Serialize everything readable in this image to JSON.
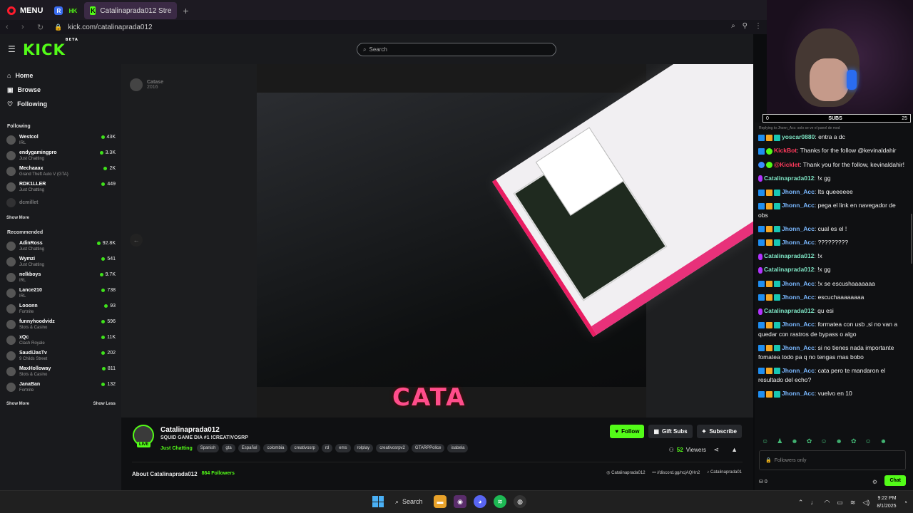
{
  "browser": {
    "menu_label": "MENU",
    "tab_favicons": [
      "R",
      "HK"
    ],
    "tab_title": "Catalinaprada012 Stre",
    "url": "kick.com/catalinaprada012"
  },
  "site": {
    "logo": "KICK",
    "logo_badge": "BETA",
    "search_placeholder": "Search"
  },
  "sidebar": {
    "nav": [
      {
        "label": "Home",
        "icon": "home-icon"
      },
      {
        "label": "Browse",
        "icon": "browse-icon"
      },
      {
        "label": "Following",
        "icon": "heart-icon"
      }
    ],
    "following_title": "Following",
    "following": [
      {
        "name": "Westcol",
        "category": "IRL",
        "viewers": "43K"
      },
      {
        "name": "endygamingpro",
        "category": "Just Chatting",
        "viewers": "3.3K"
      },
      {
        "name": "Mechaaax",
        "category": "Grand Theft Auto V (GTA)",
        "viewers": "2K"
      },
      {
        "name": "RDK1LLER",
        "category": "Just Chatting",
        "viewers": "449"
      },
      {
        "name": "dcmillet",
        "category": "",
        "viewers": ""
      }
    ],
    "show_more_1": "Show More",
    "recommended_title": "Recommended",
    "recommended": [
      {
        "name": "AdinRoss",
        "category": "Just Chatting",
        "viewers": "92.8K"
      },
      {
        "name": "Wymzi",
        "category": "Just Chatting",
        "viewers": "541"
      },
      {
        "name": "nelkboys",
        "category": "IRL",
        "viewers": "9.7K"
      },
      {
        "name": "Lance210",
        "category": "IRL",
        "viewers": "738"
      },
      {
        "name": "Looonn",
        "category": "Fortnite",
        "viewers": "93"
      },
      {
        "name": "funnyhoodvidz",
        "category": "Slots & Casino",
        "viewers": "596"
      },
      {
        "name": "xQc",
        "category": "Clash Royale",
        "viewers": "11K"
      },
      {
        "name": "SaudiJasTv",
        "category": "9 Childs Street",
        "viewers": "202"
      },
      {
        "name": "MaxHolloway",
        "category": "Slots & Casino",
        "viewers": "811"
      },
      {
        "name": "JanaBan",
        "category": "Fortnite",
        "viewers": "132"
      }
    ],
    "show_more_2": "Show More",
    "show_less": "Show Less"
  },
  "video": {
    "overlay_text": "CATA",
    "inner_channel": "Catase",
    "inner_status": "2016"
  },
  "stream": {
    "streamer": "Catalinaprada012",
    "live_badge": "LIVE",
    "title": "SQUID GAME DIA #1 !CREATIVOSRP",
    "category": "Just Chatting",
    "tags": [
      "Spanish",
      "gta",
      "Español",
      "colombia",
      "creativosrp",
      "rd",
      "ems",
      "rolplay",
      "creativosrpv2",
      "GTARPPolice",
      "isabela"
    ],
    "follow_label": "Follow",
    "gift_label": "Gift Subs",
    "subscribe_label": "Subscribe",
    "viewers": "52",
    "viewers_label": "Viewers",
    "about_label": "About Catalinaprada012",
    "followers_count": "864",
    "followers_label": "Followers",
    "links": [
      "Catalinaprada012",
      "//discord.gg/ncjAQHn2",
      "Catalinaprada01"
    ]
  },
  "overlay": {
    "subs_min": "0",
    "subs_label": "SUBS",
    "subs_max": "25"
  },
  "chat": {
    "reply_note": "Replying to Jhonn_Acc: solo se ve el panel de mod",
    "messages": [
      {
        "user": "yoscar0880",
        "text": "entra a dc",
        "color": "#7ee4c4",
        "badges": [
          "v",
          "o",
          "t"
        ]
      },
      {
        "user": "KickBot",
        "text": "Thanks for the follow @kevinaldahir",
        "color": "#ff3b5c",
        "badges": [
          "v",
          "g"
        ]
      },
      {
        "user": "@Kicklet",
        "text": "Thank you for the follow, kevinaldahir!",
        "color": "#ff3b5c",
        "badges": [
          "bl",
          "g"
        ]
      },
      {
        "user": "Catalinaprada012",
        "text": "!x gg",
        "color": "#7ee4c4",
        "badges": [
          "p"
        ]
      },
      {
        "user": "Jhonn_Acc",
        "text": "Its queeeeee",
        "color": "#7ab8ff",
        "badges": [
          "v",
          "o",
          "t"
        ]
      },
      {
        "user": "Jhonn_Acc",
        "text": "pega el link en navegador de obs",
        "color": "#7ab8ff",
        "badges": [
          "v",
          "o",
          "t"
        ]
      },
      {
        "user": "Jhonn_Acc",
        "text": "cual es el !",
        "color": "#7ab8ff",
        "badges": [
          "v",
          "o",
          "t"
        ]
      },
      {
        "user": "Jhonn_Acc",
        "text": "?????????",
        "color": "#7ab8ff",
        "badges": [
          "v",
          "o",
          "t"
        ]
      },
      {
        "user": "Catalinaprada012",
        "text": "!x",
        "color": "#7ee4c4",
        "badges": [
          "p"
        ]
      },
      {
        "user": "Catalinaprada012",
        "text": "!x gg",
        "color": "#7ee4c4",
        "badges": [
          "p"
        ]
      },
      {
        "user": "Jhonn_Acc",
        "text": "!x se escushaaaaaaa",
        "color": "#7ab8ff",
        "badges": [
          "v",
          "o",
          "t"
        ]
      },
      {
        "user": "Jhonn_Acc",
        "text": "escuchaaaaaaaa",
        "color": "#7ab8ff",
        "badges": [
          "v",
          "o",
          "t"
        ]
      },
      {
        "user": "Catalinaprada012",
        "text": "qu esi",
        "color": "#7ee4c4",
        "badges": [
          "p"
        ]
      },
      {
        "user": "Jhonn_Acc",
        "text": "formatea con usb ,si no van a quedar con rastros de bypass o algo",
        "color": "#7ab8ff",
        "badges": [
          "v",
          "o",
          "t"
        ]
      },
      {
        "user": "Jhonn_Acc",
        "text": "si no tienes nada importante fomatea todo pa q no tengas mas bobo",
        "color": "#7ab8ff",
        "badges": [
          "v",
          "o",
          "t"
        ]
      },
      {
        "user": "Jhonn_Acc",
        "text": "cata pero te mandaron el resultado del echo?",
        "color": "#7ab8ff",
        "badges": [
          "v",
          "o",
          "t"
        ]
      },
      {
        "user": "Jhonn_Acc",
        "text": "vuelvo en 10",
        "color": "#7ab8ff",
        "badges": [
          "v",
          "o",
          "t"
        ]
      }
    ],
    "input_placeholder": "Followers only",
    "count": "0",
    "send_label": "Chat"
  },
  "taskbar": {
    "search_label": "Search",
    "time": "9:22 PM",
    "date": "8/1/2025"
  }
}
